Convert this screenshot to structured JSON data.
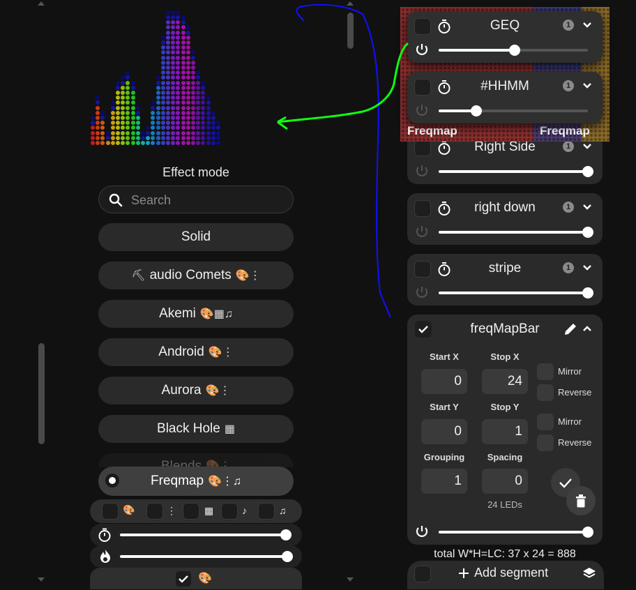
{
  "effects_panel": {
    "title": "Effect mode",
    "search_placeholder": "Search",
    "items": [
      {
        "name": "Solid",
        "flags": ""
      },
      {
        "name": "audio Comets",
        "flags": "🎨⋮",
        "prefix": "⛏"
      },
      {
        "name": "Akemi",
        "flags": "🎨▦♫"
      },
      {
        "name": "Android",
        "flags": "🎨⋮"
      },
      {
        "name": "Aurora",
        "flags": "🎨⋮"
      },
      {
        "name": "Black Hole",
        "flags": "▦"
      },
      {
        "name": "Blends",
        "flags": "🎨⋮"
      }
    ],
    "selected": {
      "name": "Freqmap",
      "flags": "🎨⋮♫"
    },
    "filters": [
      "palette-icon",
      "dots-icon",
      "matrix-icon",
      "note-icon",
      "notes-icon"
    ],
    "speed_level": 0.95,
    "intensity_level": 0.96
  },
  "segments": [
    {
      "name": "GEQ",
      "badge": "1",
      "brightness": 0.51
    },
    {
      "name": "#HHMM",
      "badge": "1",
      "brightness": 0.25
    },
    {
      "name": "Right Side",
      "badge": "1",
      "brightness": 1.0
    },
    {
      "name": "right down",
      "badge": "1",
      "brightness": 1.0
    },
    {
      "name": "stripe",
      "badge": "1",
      "brightness": 1.0
    }
  ],
  "active_segment": {
    "name": "freqMapBar",
    "labels": {
      "start_x": "Start X",
      "stop_x": "Stop X",
      "start_y": "Start Y",
      "stop_y": "Stop Y",
      "grouping": "Grouping",
      "spacing": "Spacing",
      "mirror": "Mirror",
      "reverse": "Reverse"
    },
    "start_x": "0",
    "stop_x": "24",
    "start_y": "0",
    "stop_y": "1",
    "grouping": "1",
    "spacing": "0",
    "led_count": "24 LEDs",
    "brightness": 1.0
  },
  "total_text": "total W*H=LC: 37 x 24 = 888",
  "add_segment_label": "Add segment",
  "preview_labels": {
    "left": "Freqmap",
    "right": "Freqmap"
  },
  "colors": {
    "accent": "#ffffff",
    "panel": "#2a2a2a",
    "background": "#111111"
  }
}
